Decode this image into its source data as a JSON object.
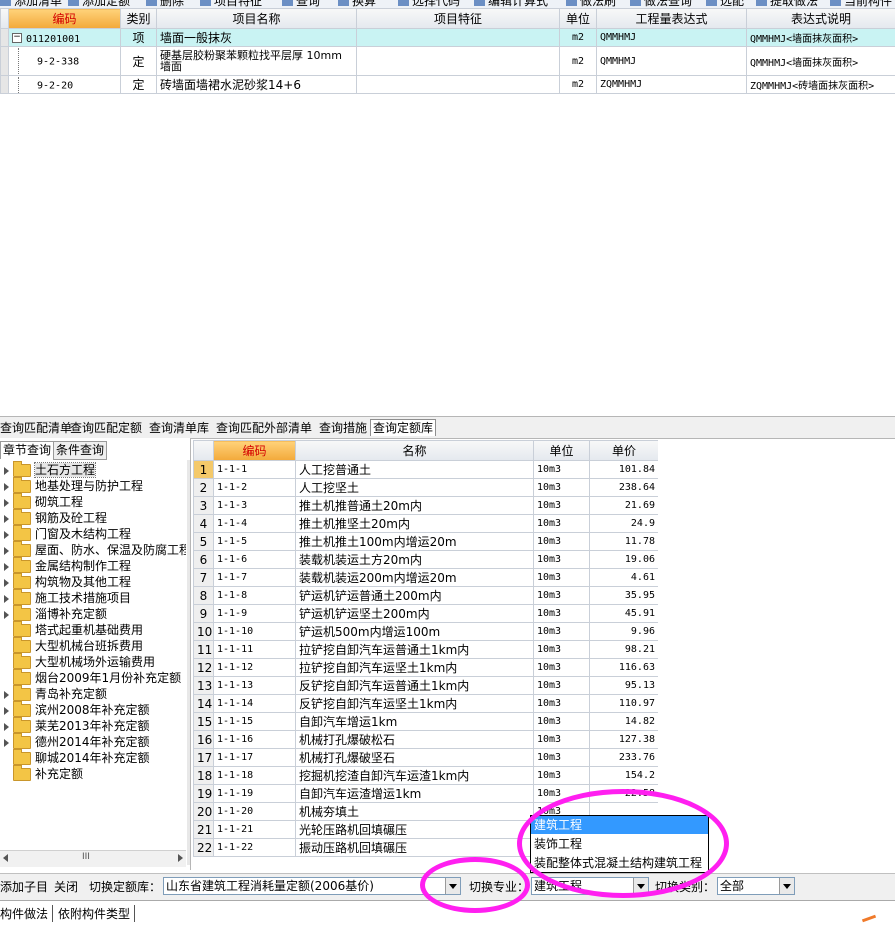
{
  "toolbar": {
    "items": [
      "添加清单",
      "添加定额",
      "删除",
      "项目特征",
      "查询",
      "换算",
      "选择代码",
      "编辑计算式",
      "做法刷",
      "做法查询",
      "选配",
      "提取做法",
      "当前构件"
    ]
  },
  "top_grid": {
    "headers": [
      "编码",
      "类别",
      "项目名称",
      "项目特征",
      "单位",
      "工程量表达式",
      "表达式说明"
    ],
    "rows": [
      {
        "code": "011201001",
        "type": "项",
        "name": "墙面一般抹灰",
        "feature": "",
        "unit": "m2",
        "expr": "QMMHMJ",
        "desc": "QMMHMJ<墙面抹灰面积>"
      },
      {
        "code": "9-2-338",
        "type": "定",
        "name_line1": "硬基层胶粉聚苯颗粒找平层厚 10mm",
        "name_line2": "墙面",
        "feature": "",
        "unit": "m2",
        "expr": "QMMHMJ",
        "desc": "QMMHMJ<墙面抹灰面积>"
      },
      {
        "code": "9-2-20",
        "type": "定",
        "name": "砖墙面墙裙水泥砂浆14+6",
        "feature": "",
        "unit": "m2",
        "expr": "ZQMMHMJ",
        "desc": "ZQMMHMJ<砖墙面抹灰面积>"
      }
    ]
  },
  "tabs": [
    "查询匹配清单",
    "查询匹配定额",
    "查询清单库",
    "查询匹配外部清单",
    "查询措施",
    "查询定额库"
  ],
  "subtabs": [
    "章节查询",
    "条件查询"
  ],
  "tree": [
    {
      "label": "土石方工程",
      "expandable": true
    },
    {
      "label": "地基处理与防护工程",
      "expandable": true
    },
    {
      "label": "砌筑工程",
      "expandable": true
    },
    {
      "label": "钢筋及砼工程",
      "expandable": true
    },
    {
      "label": "门窗及木结构工程",
      "expandable": true
    },
    {
      "label": "屋面、防水、保温及防腐工程",
      "expandable": true
    },
    {
      "label": "金属结构制作工程",
      "expandable": true
    },
    {
      "label": "构筑物及其他工程",
      "expandable": true
    },
    {
      "label": "施工技术措施项目",
      "expandable": true
    },
    {
      "label": "淄博补充定额",
      "expandable": true
    },
    {
      "label": "塔式起重机基础费用",
      "expandable": false
    },
    {
      "label": "大型机械台班拆费用",
      "expandable": false
    },
    {
      "label": "大型机械场外运输费用",
      "expandable": false
    },
    {
      "label": "烟台2009年1月份补充定额",
      "expandable": false
    },
    {
      "label": "青岛补充定额",
      "expandable": true
    },
    {
      "label": "滨州2008年补充定额",
      "expandable": true
    },
    {
      "label": "莱芜2013年补充定额",
      "expandable": true
    },
    {
      "label": "德州2014年补充定额",
      "expandable": true
    },
    {
      "label": "聊城2014年补充定额",
      "expandable": false
    },
    {
      "label": "补充定额",
      "expandable": false
    }
  ],
  "scroll_glyph": "III",
  "bottom_grid": {
    "headers": [
      "编码",
      "名称",
      "单位",
      "单价"
    ],
    "rows": [
      {
        "n": "1",
        "code": "1-1-1",
        "name": "人工挖普通土",
        "unit": "10m3",
        "price": "101.84"
      },
      {
        "n": "2",
        "code": "1-1-2",
        "name": "人工挖坚土",
        "unit": "10m3",
        "price": "238.64"
      },
      {
        "n": "3",
        "code": "1-1-3",
        "name": "推土机推普通土20m内",
        "unit": "10m3",
        "price": "21.69"
      },
      {
        "n": "4",
        "code": "1-1-4",
        "name": "推土机推坚土20m内",
        "unit": "10m3",
        "price": "24.9"
      },
      {
        "n": "5",
        "code": "1-1-5",
        "name": "推土机推土100m内增运20m",
        "unit": "10m3",
        "price": "11.78"
      },
      {
        "n": "6",
        "code": "1-1-6",
        "name": "装载机装运土方20m内",
        "unit": "10m3",
        "price": "19.06"
      },
      {
        "n": "7",
        "code": "1-1-7",
        "name": "装载机装运200m内增运20m",
        "unit": "10m3",
        "price": "4.61"
      },
      {
        "n": "8",
        "code": "1-1-8",
        "name": "铲运机铲运普通土200m内",
        "unit": "10m3",
        "price": "35.95"
      },
      {
        "n": "9",
        "code": "1-1-9",
        "name": "铲运机铲运坚土200m内",
        "unit": "10m3",
        "price": "45.91"
      },
      {
        "n": "10",
        "code": "1-1-10",
        "name": "铲运机500m内增运100m",
        "unit": "10m3",
        "price": "9.96"
      },
      {
        "n": "11",
        "code": "1-1-11",
        "name": "拉铲挖自卸汽车运普通土1km内",
        "unit": "10m3",
        "price": "98.21"
      },
      {
        "n": "12",
        "code": "1-1-12",
        "name": "拉铲挖自卸汽车运坚土1km内",
        "unit": "10m3",
        "price": "116.63"
      },
      {
        "n": "13",
        "code": "1-1-13",
        "name": "反铲挖自卸汽车运普通土1km内",
        "unit": "10m3",
        "price": "95.13"
      },
      {
        "n": "14",
        "code": "1-1-14",
        "name": "反铲挖自卸汽车运坚土1km内",
        "unit": "10m3",
        "price": "110.97"
      },
      {
        "n": "15",
        "code": "1-1-15",
        "name": "自卸汽车增运1km",
        "unit": "10m3",
        "price": "14.82"
      },
      {
        "n": "16",
        "code": "1-1-16",
        "name": "机械打孔爆破松石",
        "unit": "10m3",
        "price": "127.38"
      },
      {
        "n": "17",
        "code": "1-1-17",
        "name": "机械打孔爆破坚石",
        "unit": "10m3",
        "price": "233.76"
      },
      {
        "n": "18",
        "code": "1-1-18",
        "name": "挖掘机挖渣自卸汽车运渣1km内",
        "unit": "10m3",
        "price": "154.2"
      },
      {
        "n": "19",
        "code": "1-1-19",
        "name": "自卸汽车运渣增运1km",
        "unit": "10m3",
        "price": "22.58"
      },
      {
        "n": "20",
        "code": "1-1-20",
        "name": "机械夯填土",
        "unit": "10m3",
        "price": ""
      },
      {
        "n": "21",
        "code": "1-1-21",
        "name": "光轮压路机回填碾压",
        "unit": "10m3",
        "price": ""
      },
      {
        "n": "22",
        "code": "1-1-22",
        "name": "振动压路机回填碾压",
        "unit": "10m3",
        "price": ""
      }
    ]
  },
  "status": {
    "add_child": "添加子目",
    "close": "关闭",
    "switch_lib_label": "切换定额库：",
    "lib_value": "山东省建筑工程消耗量定额(2006基价)",
    "switch_spec_label": "切换专业：",
    "spec_value": "建筑工程",
    "switch_cat_label": "切换类别：",
    "cat_value": "全部"
  },
  "dropdown": {
    "options": [
      "建筑工程",
      "装饰工程",
      "装配整体式混凝土结构建筑工程"
    ],
    "highlighted": 0
  },
  "bottom_tabs": [
    "构件做法",
    "依附构件类型"
  ],
  "colors": {
    "header_orange": "#f2a93a",
    "selected_row": "#c9f3f3",
    "highlight_blue": "#3399ff",
    "annotation_magenta": "#ff1ff0"
  }
}
